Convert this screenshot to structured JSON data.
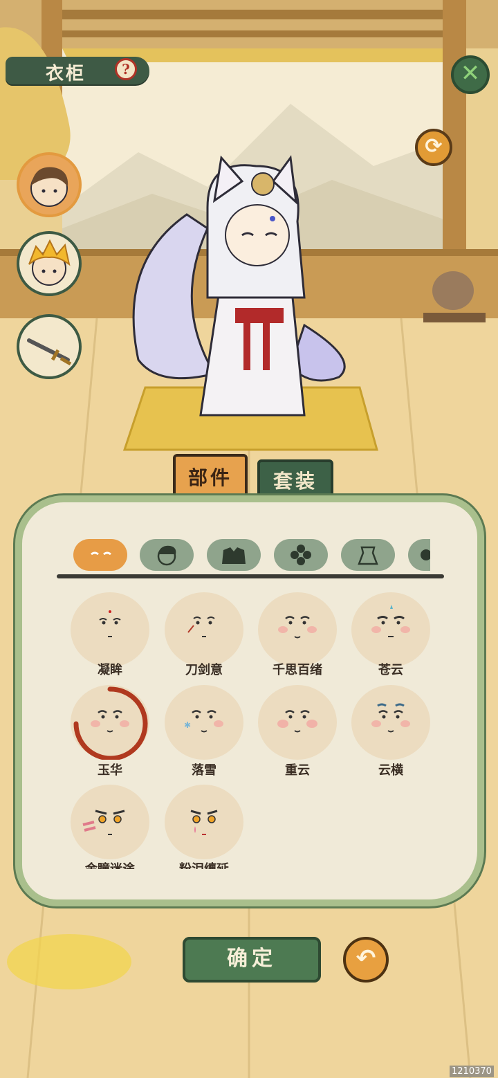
{
  "header": {
    "title": "衣柜",
    "help_glyph": "?"
  },
  "controls": {
    "close_icon": "x-icon",
    "close_glyph": "✕",
    "refresh_glyph": "⟳",
    "undo_glyph": "↶"
  },
  "side_characters": [
    {
      "name": "brown-haired-hero-avatar"
    },
    {
      "name": "blonde-hero-avatar"
    },
    {
      "name": "sword-item"
    }
  ],
  "tabs": [
    {
      "label": "部件",
      "selected": true
    },
    {
      "label": "套装",
      "selected": false
    }
  ],
  "categories": [
    {
      "icon": "face-icon",
      "selected": true
    },
    {
      "icon": "hair-icon",
      "selected": false
    },
    {
      "icon": "clothing-icon",
      "selected": false
    },
    {
      "icon": "flower-icon",
      "selected": false
    },
    {
      "icon": "accessory-icon",
      "selected": false
    },
    {
      "icon": "more-icon",
      "selected": false
    }
  ],
  "faces": [
    {
      "label": "凝眸"
    },
    {
      "label": "刀剑意"
    },
    {
      "label": "千思百绪"
    },
    {
      "label": "苍云"
    },
    {
      "label": "玉华",
      "selected": true
    },
    {
      "label": "落雪"
    },
    {
      "label": "重云"
    },
    {
      "label": "云横"
    },
    {
      "label": "金瞳迷途"
    },
    {
      "label": "粉泪缠延"
    }
  ],
  "buttons": {
    "confirm": "确定"
  },
  "build_id": "1210370",
  "colors": {
    "accent_orange": "#e79c46",
    "accent_green": "#3d6147",
    "selection_ring": "#b0391f"
  }
}
